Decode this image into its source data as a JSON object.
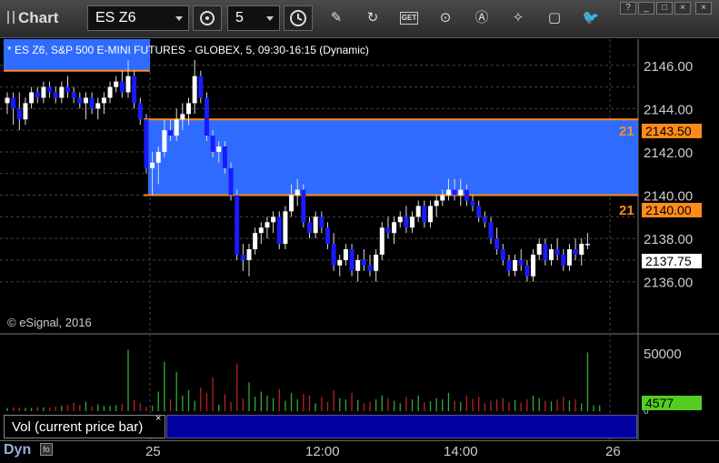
{
  "app": {
    "title": "Chart"
  },
  "toolbar": {
    "symbol": "ES Z6",
    "interval": "5",
    "icons": [
      "cursor-settings-icon",
      "clock-icon",
      "pencil-icon",
      "refresh-icon",
      "get-icon",
      "play-icon",
      "alert-icon",
      "tools-icon",
      "comment-icon",
      "twitter-icon"
    ],
    "get_label": "GET",
    "window_buttons": [
      "?",
      "_",
      "□",
      "×"
    ]
  },
  "chart": {
    "header": "* ES Z6, S&P 500 E-MINI FUTURES - GLOBEX, 5, 09:30-16:15 (Dynamic)",
    "copyright": "© eSignal, 2016",
    "price_axis": [
      "2146.00",
      "2144.00",
      "2142.00",
      "2140.00",
      "2138.00",
      "2136.00"
    ],
    "price_tags": {
      "upper": "2143.50",
      "lower": "2140.00",
      "last": "2137.75"
    },
    "line_numbers": {
      "upper": "21",
      "lower": "21"
    },
    "colors": {
      "zone": "#2f6bff",
      "line": "#ff8c1a",
      "up_candle": "#ffffff",
      "down_candle": "#1a1aff",
      "vol_up": "#33aa33",
      "vol_down": "#bb2222"
    }
  },
  "volume": {
    "label": "Vol (current price bar)",
    "close": "×",
    "axis": [
      "50000",
      "0"
    ],
    "last_value": "4577"
  },
  "timebar": {
    "mode": "Dyn",
    "labels": [
      "25",
      "12:00",
      "14:00",
      "26"
    ]
  },
  "chart_data": {
    "type": "candlestick",
    "ylim": [
      2135.0,
      2147.5
    ],
    "zones": [
      {
        "low": 2145.75,
        "high": 2147.5,
        "start": 0,
        "end": 23
      },
      {
        "low": 2140.0,
        "high": 2143.5,
        "start": 23,
        "end": 99
      }
    ],
    "candles": [
      [
        2144.25,
        2144.75,
        2143.75,
        2144.5
      ],
      [
        2144.5,
        2144.75,
        2143.25,
        2144.0
      ],
      [
        2144.0,
        2144.75,
        2143.0,
        2143.5
      ],
      [
        2143.5,
        2144.5,
        2143.25,
        2144.25
      ],
      [
        2144.25,
        2145.0,
        2144.0,
        2144.75
      ],
      [
        2144.75,
        2145.0,
        2144.25,
        2144.5
      ],
      [
        2144.5,
        2145.25,
        2144.25,
        2145.0
      ],
      [
        2145.0,
        2145.25,
        2144.5,
        2144.75
      ],
      [
        2144.75,
        2145.0,
        2144.25,
        2144.5
      ],
      [
        2144.5,
        2145.25,
        2144.25,
        2145.0
      ],
      [
        2145.0,
        2145.5,
        2144.5,
        2144.75
      ],
      [
        2144.75,
        2145.0,
        2144.25,
        2144.5
      ],
      [
        2144.5,
        2144.75,
        2144.0,
        2144.25
      ],
      [
        2144.25,
        2144.75,
        2143.5,
        2144.5
      ],
      [
        2144.5,
        2144.75,
        2143.75,
        2144.0
      ],
      [
        2144.0,
        2144.5,
        2143.5,
        2144.25
      ],
      [
        2144.25,
        2144.75,
        2143.75,
        2144.5
      ],
      [
        2144.5,
        2145.25,
        2144.25,
        2145.0
      ],
      [
        2145.0,
        2145.5,
        2144.75,
        2145.25
      ],
      [
        2145.25,
        2145.75,
        2144.5,
        2144.75
      ],
      [
        2144.75,
        2146.25,
        2144.5,
        2145.5
      ],
      [
        2145.5,
        2145.75,
        2144.0,
        2144.25
      ],
      [
        2144.25,
        2144.5,
        2143.25,
        2143.5
      ],
      [
        2143.5,
        2143.75,
        2141.0,
        2141.25
      ],
      [
        2141.25,
        2142.0,
        2140.0,
        2141.5
      ],
      [
        2141.5,
        2142.25,
        2140.5,
        2142.0
      ],
      [
        2142.0,
        2143.5,
        2141.75,
        2143.0
      ],
      [
        2143.0,
        2143.5,
        2142.5,
        2142.75
      ],
      [
        2142.75,
        2144.0,
        2142.5,
        2143.5
      ],
      [
        2143.5,
        2144.25,
        2143.0,
        2143.75
      ],
      [
        2143.75,
        2144.5,
        2143.25,
        2144.25
      ],
      [
        2144.25,
        2146.25,
        2143.75,
        2145.5
      ],
      [
        2145.5,
        2145.75,
        2144.25,
        2144.5
      ],
      [
        2144.5,
        2144.75,
        2142.5,
        2142.75
      ],
      [
        2142.75,
        2143.0,
        2141.75,
        2142.0
      ],
      [
        2142.0,
        2142.5,
        2141.5,
        2142.25
      ],
      [
        2142.25,
        2142.5,
        2141.0,
        2141.25
      ],
      [
        2141.25,
        2141.5,
        2139.75,
        2140.0
      ],
      [
        2140.0,
        2140.25,
        2137.0,
        2137.25
      ],
      [
        2137.25,
        2137.75,
        2136.5,
        2137.0
      ],
      [
        2137.0,
        2137.75,
        2136.25,
        2137.5
      ],
      [
        2137.5,
        2138.5,
        2137.25,
        2138.25
      ],
      [
        2138.25,
        2138.75,
        2137.75,
        2138.5
      ],
      [
        2138.5,
        2139.0,
        2138.0,
        2138.75
      ],
      [
        2138.75,
        2139.25,
        2138.25,
        2139.0
      ],
      [
        2139.0,
        2139.25,
        2137.5,
        2137.75
      ],
      [
        2137.75,
        2139.5,
        2137.5,
        2139.25
      ],
      [
        2139.25,
        2140.5,
        2139.0,
        2140.0
      ],
      [
        2140.0,
        2140.75,
        2139.5,
        2140.25
      ],
      [
        2140.25,
        2140.5,
        2138.5,
        2138.75
      ],
      [
        2138.75,
        2139.0,
        2138.0,
        2138.25
      ],
      [
        2138.25,
        2139.25,
        2138.0,
        2139.0
      ],
      [
        2139.0,
        2139.25,
        2138.25,
        2138.5
      ],
      [
        2138.5,
        2138.75,
        2137.5,
        2137.75
      ],
      [
        2137.75,
        2138.25,
        2136.5,
        2136.75
      ],
      [
        2136.75,
        2137.25,
        2136.25,
        2137.0
      ],
      [
        2137.0,
        2137.75,
        2136.75,
        2137.5
      ],
      [
        2137.5,
        2137.75,
        2136.25,
        2136.5
      ],
      [
        2136.5,
        2137.25,
        2136.0,
        2137.0
      ],
      [
        2137.0,
        2137.5,
        2136.5,
        2136.75
      ],
      [
        2136.75,
        2137.25,
        2136.25,
        2136.5
      ],
      [
        2136.5,
        2137.5,
        2136.0,
        2137.25
      ],
      [
        2137.25,
        2138.75,
        2137.0,
        2138.5
      ],
      [
        2138.5,
        2139.0,
        2138.0,
        2138.25
      ],
      [
        2138.25,
        2139.0,
        2137.75,
        2138.75
      ],
      [
        2138.75,
        2139.25,
        2138.5,
        2139.0
      ],
      [
        2139.0,
        2139.5,
        2138.25,
        2138.5
      ],
      [
        2138.5,
        2139.25,
        2138.25,
        2139.0
      ],
      [
        2139.0,
        2139.75,
        2138.75,
        2139.5
      ],
      [
        2139.5,
        2139.75,
        2138.5,
        2138.75
      ],
      [
        2138.75,
        2139.75,
        2138.5,
        2139.5
      ],
      [
        2139.5,
        2140.0,
        2139.0,
        2139.75
      ],
      [
        2139.75,
        2140.25,
        2139.5,
        2140.0
      ],
      [
        2140.0,
        2140.75,
        2139.75,
        2140.25
      ],
      [
        2140.25,
        2140.75,
        2139.75,
        2140.0
      ],
      [
        2140.0,
        2140.75,
        2139.5,
        2140.25
      ],
      [
        2140.25,
        2140.5,
        2139.5,
        2139.75
      ],
      [
        2139.75,
        2140.0,
        2139.25,
        2139.5
      ],
      [
        2139.5,
        2139.75,
        2138.75,
        2139.0
      ],
      [
        2139.0,
        2139.25,
        2138.5,
        2138.75
      ],
      [
        2138.75,
        2139.0,
        2137.75,
        2138.0
      ],
      [
        2138.0,
        2138.5,
        2137.25,
        2137.5
      ],
      [
        2137.5,
        2137.75,
        2136.75,
        2137.0
      ],
      [
        2137.0,
        2137.25,
        2136.25,
        2136.5
      ],
      [
        2136.5,
        2137.25,
        2136.25,
        2137.0
      ],
      [
        2137.0,
        2137.5,
        2136.5,
        2136.75
      ],
      [
        2136.75,
        2137.0,
        2136.0,
        2136.25
      ],
      [
        2136.25,
        2137.5,
        2136.0,
        2137.25
      ],
      [
        2137.25,
        2138.0,
        2137.0,
        2137.75
      ],
      [
        2137.75,
        2138.0,
        2136.75,
        2137.0
      ],
      [
        2137.0,
        2137.75,
        2136.75,
        2137.5
      ],
      [
        2137.5,
        2138.0,
        2137.0,
        2137.25
      ],
      [
        2137.25,
        2137.5,
        2136.5,
        2136.75
      ],
      [
        2136.75,
        2137.75,
        2136.5,
        2137.5
      ],
      [
        2137.5,
        2138.0,
        2137.0,
        2137.25
      ],
      [
        2137.25,
        2138.0,
        2136.75,
        2137.75
      ],
      [
        2137.75,
        2138.25,
        2137.5,
        2137.75
      ]
    ],
    "volumes": [
      2500,
      3000,
      2800,
      2600,
      2400,
      3100,
      2900,
      2700,
      3500,
      4200,
      5000,
      6500,
      4800,
      7200,
      3800,
      5200,
      4100,
      3900,
      4600,
      5500,
      47000,
      8500,
      6000,
      3500,
      4200,
      15000,
      38000,
      9000,
      30000,
      12000,
      16000,
      8000,
      18000,
      14000,
      26000,
      5000,
      13000,
      7000,
      36000,
      9500,
      22000,
      11000,
      15000,
      12000,
      10000,
      17000,
      8000,
      14000,
      9000,
      13000,
      12000,
      6000,
      11000,
      7000,
      16000,
      10000,
      9000,
      14000,
      8500,
      6000,
      7000,
      9000,
      12000,
      10000,
      8000,
      6000,
      11000,
      9000,
      12000,
      7000,
      7500,
      10000,
      9000,
      14000,
      8000,
      7000,
      12000,
      9500,
      11000,
      6000,
      8000,
      9000,
      10000,
      7000,
      8500,
      6500,
      9000,
      12000,
      10000,
      8000,
      7500,
      9000,
      11000,
      8000,
      9000,
      6000,
      45000,
      4577,
      4577
    ]
  }
}
